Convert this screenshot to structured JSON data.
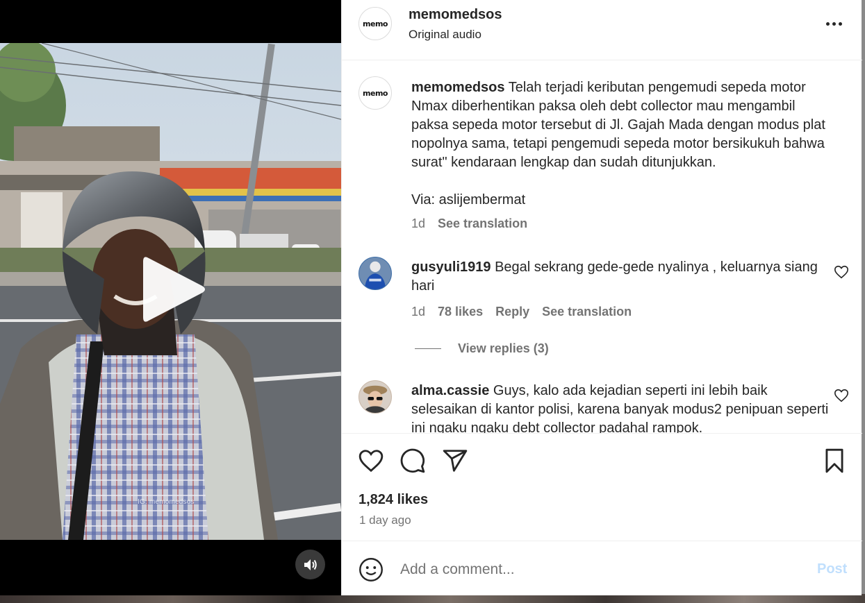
{
  "header": {
    "username": "memomedsos",
    "audio": "Original audio",
    "avatar_text": "memo"
  },
  "video": {
    "watermark": "IG: memomedsos",
    "play_icon": "play-icon",
    "sound_icon": "speaker-icon"
  },
  "caption": {
    "username": "memomedsos",
    "text": "Telah terjadi keributan pengemudi sepeda motor Nmax diberhentikan paksa oleh debt collector mau mengambil paksa sepeda motor tersebut di Jl. Gajah Mada dengan modus plat nopolnya sama, tetapi pengemudi sepeda motor bersikukuh bahwa surat\" kendaraan lengkap dan sudah ditunjukkan.",
    "via": "Via: aslijembermat",
    "time": "1d",
    "translate": "See translation"
  },
  "comments": [
    {
      "username": "gusyuli1919",
      "text": "Begal sekrang gede-gede nyalinya , keluarnya siang hari",
      "time": "1d",
      "likes": "78 likes",
      "reply": "Reply",
      "translate": "See translation",
      "view_replies": "View replies (3)"
    },
    {
      "username": "alma.cassie",
      "text": "Guys, kalo ada kejadian seperti ini lebih baik selesaikan di kantor polisi, karena banyak modus2 penipuan seperti ini ngaku ngaku debt collector padahal rampok."
    }
  ],
  "actions": {
    "likes": "1,824 likes",
    "time_ago": "1 day ago",
    "icons": [
      "heart-icon",
      "comment-icon",
      "share-icon",
      "bookmark-icon"
    ]
  },
  "comment_box": {
    "placeholder": "Add a comment...",
    "post_label": "Post"
  },
  "colors": {
    "text": "#262626",
    "secondary": "#737373",
    "post_disabled": "#c0dffd"
  }
}
